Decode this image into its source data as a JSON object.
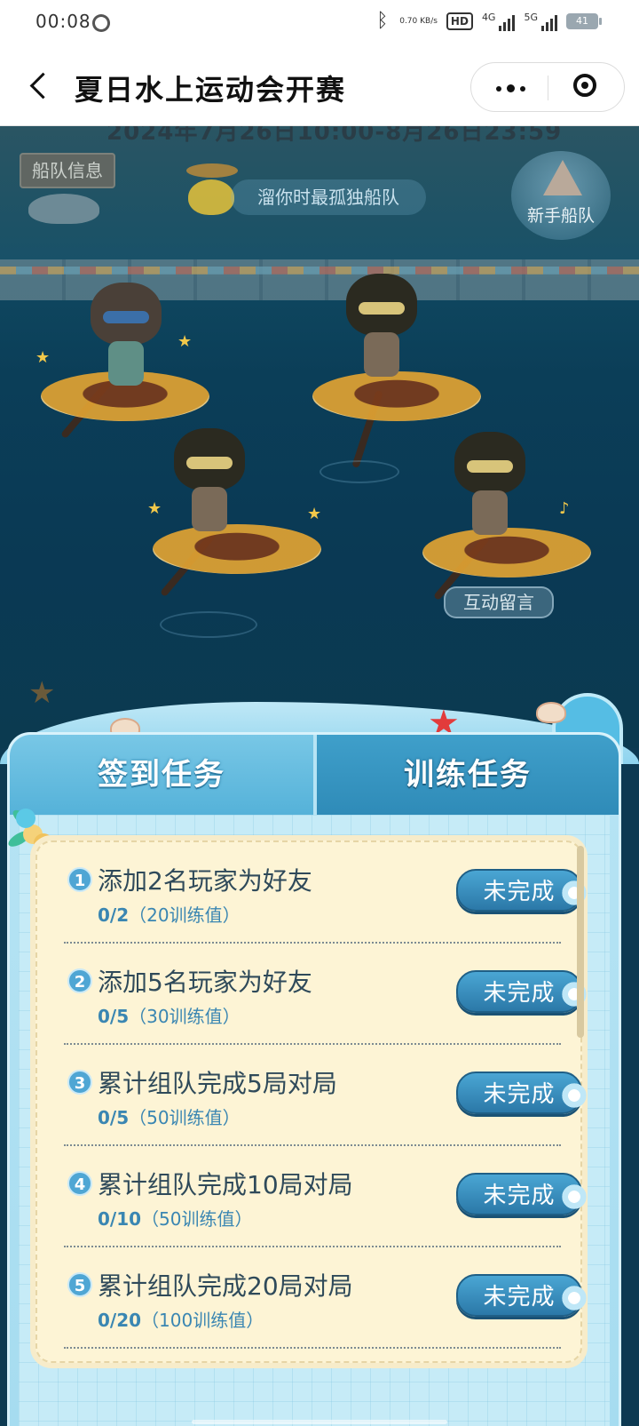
{
  "status_bar": {
    "time": "00:08",
    "network_speed": "0.70 KB/s",
    "hd_label": "HD",
    "signal_4g": "4G",
    "signal_5g": "5G",
    "battery": "41"
  },
  "title_bar": {
    "title": "夏日水上运动会开赛"
  },
  "scene": {
    "date_peek": "2024年7月26日10:00-8月26日23:59",
    "crew_info_label": "船队信息",
    "team_name": "溜你时最孤独船队",
    "newbie_label": "新手船队",
    "message_button": "互动留言"
  },
  "tabs": [
    {
      "label": "签到任务",
      "active": false
    },
    {
      "label": "训练任务",
      "active": true
    }
  ],
  "tasks": [
    {
      "num": "1",
      "name": "添加2名玩家为好友",
      "progress": "0/2",
      "reward": "（20训练值）",
      "status": "未完成"
    },
    {
      "num": "2",
      "name": "添加5名玩家为好友",
      "progress": "0/5",
      "reward": "（30训练值）",
      "status": "未完成"
    },
    {
      "num": "3",
      "name": "累计组队完成5局对局",
      "progress": "0/5",
      "reward": "（50训练值）",
      "status": "未完成"
    },
    {
      "num": "4",
      "name": "累计组队完成10局对局",
      "progress": "0/10",
      "reward": "（50训练值）",
      "status": "未完成"
    },
    {
      "num": "5",
      "name": "累计组队完成20局对局",
      "progress": "0/20",
      "reward": "（100训练值）",
      "status": "未完成"
    }
  ],
  "colors": {
    "accent": "#2b78a8",
    "panel": "#b7e4f4",
    "card": "#fdf4d5"
  }
}
